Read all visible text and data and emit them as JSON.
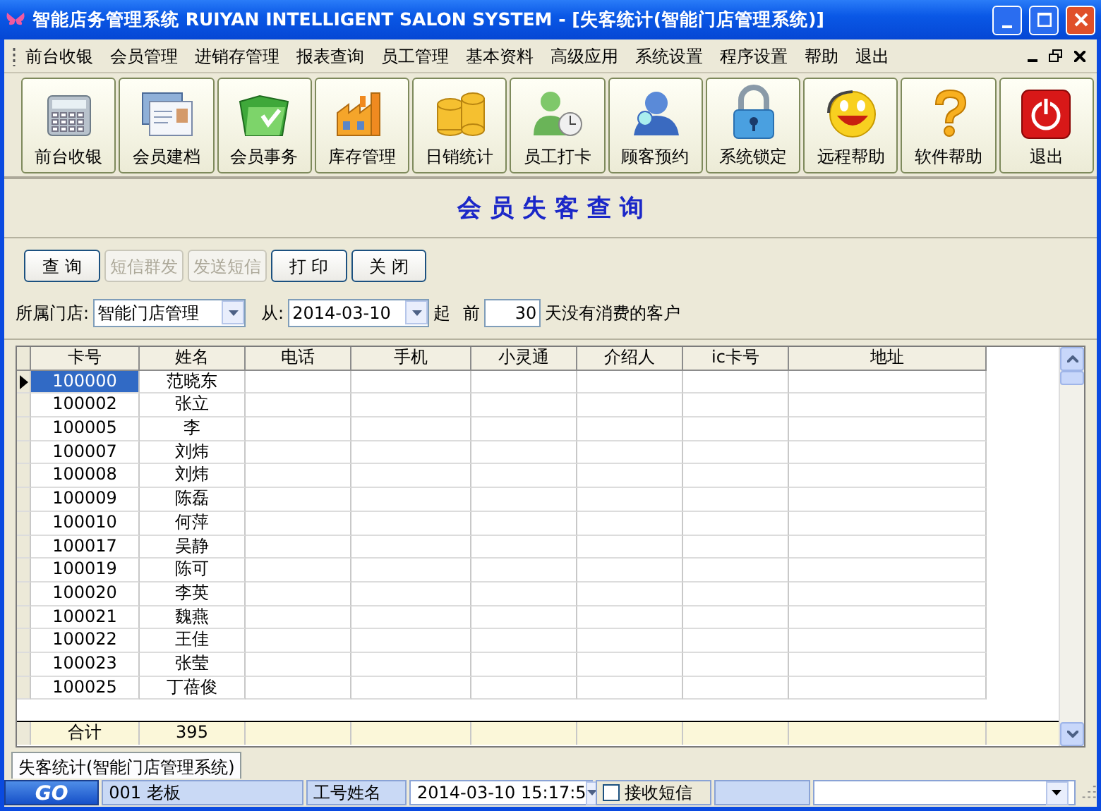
{
  "window": {
    "title": "智能店务管理系统 RUIYAN INTELLIGENT SALON SYSTEM - [失客统计(智能门店管理系统)]"
  },
  "menu": [
    "前台收银",
    "会员管理",
    "进销存管理",
    "报表查询",
    "员工管理",
    "基本资料",
    "高级应用",
    "系统设置",
    "程序设置",
    "帮助",
    "退出"
  ],
  "toolbar": [
    "前台收银",
    "会员建档",
    "会员事务",
    "库存管理",
    "日销统计",
    "员工打卡",
    "顾客预约",
    "系统锁定",
    "远程帮助",
    "软件帮助",
    "退出"
  ],
  "heading": "会 员 失 客 查 询",
  "actions": [
    {
      "label": "查 询",
      "disabled": false
    },
    {
      "label": "短信群发",
      "disabled": true
    },
    {
      "label": "发送短信",
      "disabled": true
    },
    {
      "label": "打 印",
      "disabled": false
    },
    {
      "label": "关 闭",
      "disabled": false
    }
  ],
  "filter": {
    "store_label": "所属门店:",
    "store": "智能门店管理",
    "from_label": "从:",
    "from": "2014-03-10",
    "start_label": "起",
    "before_label": "前",
    "days": "30",
    "days_suffix": "天没有消费的客户"
  },
  "grid": {
    "columns": [
      "卡号",
      "姓名",
      "电话",
      "手机",
      "小灵通",
      "介绍人",
      "ic卡号",
      "地址"
    ],
    "rows": [
      {
        "card": "100000",
        "name": "范晓东",
        "selected": true
      },
      {
        "card": "100002",
        "name": "张立",
        "selected": false
      },
      {
        "card": "100005",
        "name": "李",
        "selected": false
      },
      {
        "card": "100007",
        "name": "刘炜",
        "selected": false
      },
      {
        "card": "100008",
        "name": "刘炜",
        "selected": false
      },
      {
        "card": "100009",
        "name": "陈磊",
        "selected": false
      },
      {
        "card": "100010",
        "name": "何萍",
        "selected": false
      },
      {
        "card": "100017",
        "name": "吴静",
        "selected": false
      },
      {
        "card": "100019",
        "name": "陈可",
        "selected": false
      },
      {
        "card": "100020",
        "name": "李英",
        "selected": false
      },
      {
        "card": "100021",
        "name": "魏燕",
        "selected": false
      },
      {
        "card": "100022",
        "name": "王佳",
        "selected": false
      },
      {
        "card": "100023",
        "name": "张莹",
        "selected": false
      },
      {
        "card": "100025",
        "name": "丁蓓俊",
        "selected": false
      }
    ],
    "total": {
      "label": "合计",
      "value": "395"
    }
  },
  "tab": {
    "label": "失客统计(智能门店管理系统)",
    "selected": true
  },
  "status": {
    "go": "GO",
    "user": "001   老板",
    "user_label": "工号姓名",
    "datetime": "2014-03-10   15:17:5",
    "sms": {
      "label": "接收短信",
      "checked": false
    }
  }
}
